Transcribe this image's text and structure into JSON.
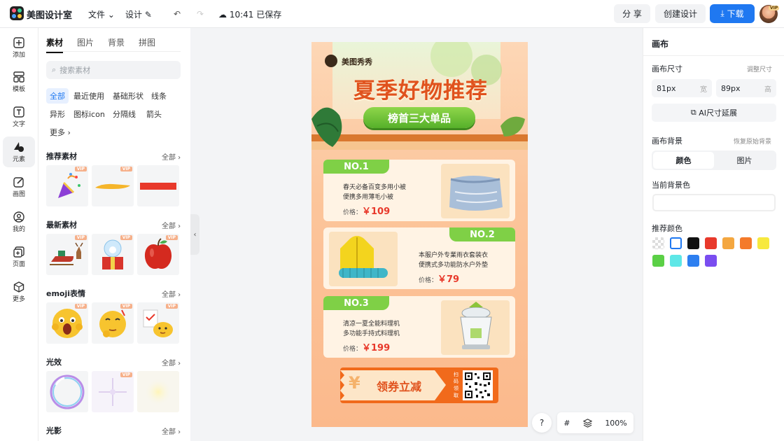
{
  "app": {
    "name": "美图设计室"
  },
  "topbar": {
    "file_label": "文件",
    "design_label": "设计",
    "save_status": "10:41 已保存",
    "share_label": "分 享",
    "create_label": "创建设计",
    "download_label": "下载",
    "vip_badge": "VIP"
  },
  "rail": [
    {
      "label": "添加",
      "icon": "plus-icon"
    },
    {
      "label": "模板",
      "icon": "template-icon"
    },
    {
      "label": "文字",
      "icon": "text-icon"
    },
    {
      "label": "元素",
      "icon": "shapes-icon"
    },
    {
      "label": "画图",
      "icon": "draw-icon"
    },
    {
      "label": "我的",
      "icon": "user-icon"
    },
    {
      "label": "页面",
      "icon": "page-icon"
    },
    {
      "label": "更多",
      "icon": "cube-icon"
    }
  ],
  "panel": {
    "tabs": [
      "素材",
      "图片",
      "背景",
      "拼图"
    ],
    "search_placeholder": "搜索素材",
    "chips": [
      "全部",
      "最近使用",
      "基础形状",
      "线条",
      "异形",
      "图标icon",
      "分隔线",
      "箭头",
      "更多"
    ],
    "all_label": "全部",
    "vip": "VIP",
    "sections": [
      "推荐素材",
      "最新素材",
      "emoji表情",
      "光效",
      "光影"
    ]
  },
  "poster": {
    "brand": "美图秀秀",
    "title": "夏季好物推荐",
    "subtitle": "榜首三大单品",
    "products": [
      {
        "no": "NO.1",
        "desc1": "春天必备百变多用小被",
        "desc2": "便携多用薄毛小被",
        "price_label": "价格：",
        "price": "￥109"
      },
      {
        "no": "NO.2",
        "desc1": "本服户外专業雨衣套装衣",
        "desc2": "便携式多功能防水户外垫",
        "price_label": "价格：",
        "price": "￥79"
      },
      {
        "no": "NO.3",
        "desc1": "清凉一夏全能料理机",
        "desc2": "多功能手持式料理机",
        "price_label": "价格：",
        "price": "￥199"
      }
    ],
    "coupon_symbol": "¥",
    "coupon_text": "领券立减",
    "qr_text": "扫码领取"
  },
  "canvas_controls": {
    "help": "?",
    "zoom": "100%"
  },
  "rightpanel": {
    "title": "画布",
    "size_label": "画布尺寸",
    "adjust_label": "调整尺寸",
    "width_value": "81px",
    "width_unit": "宽",
    "height_value": "89px",
    "height_unit": "高",
    "ai_extend": "AI尺寸延展",
    "bg_label": "画布背景",
    "restore_label": "恢复原始背景",
    "seg_color": "颜色",
    "seg_image": "图片",
    "current_bg": "当前背景色",
    "recommend": "推荐颜色",
    "swatches": [
      "transparent",
      "#ffffff",
      "#111111",
      "#e8392b",
      "#f4a740",
      "#f47a2a",
      "#f7e93e",
      "#5bd046",
      "#5ee7e7",
      "#2d7ff0",
      "#7a4df0"
    ]
  }
}
